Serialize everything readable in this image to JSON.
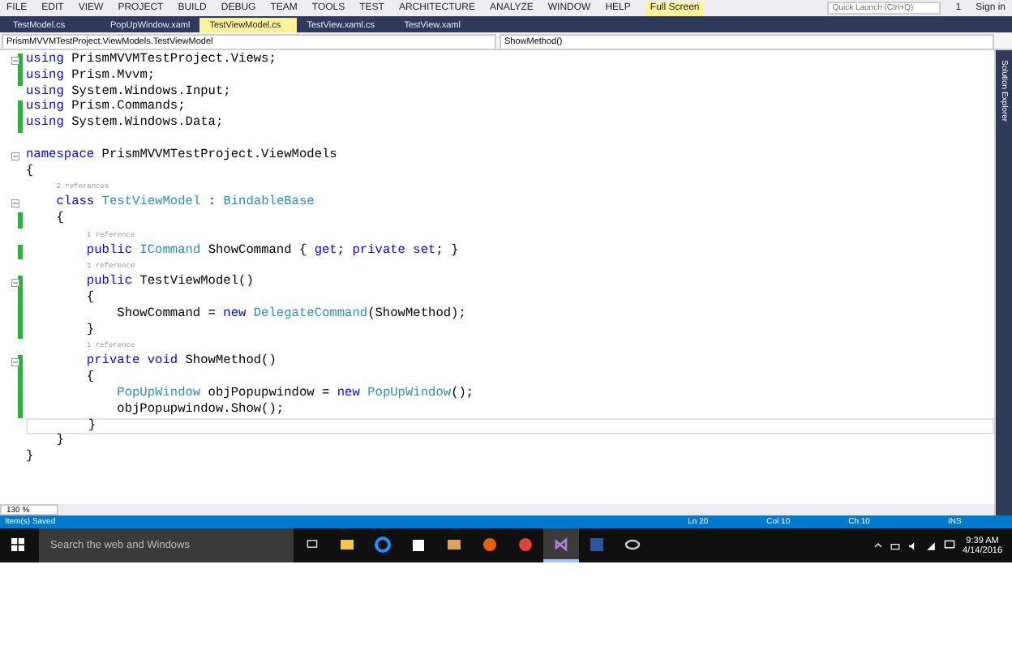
{
  "menu": {
    "items": [
      "FILE",
      "EDIT",
      "VIEW",
      "PROJECT",
      "BUILD",
      "DEBUG",
      "TEAM",
      "TOOLS",
      "TEST",
      "ARCHITECTURE",
      "ANALYZE",
      "WINDOW",
      "HELP"
    ],
    "full_screen": "Full Screen",
    "notification_count": "1",
    "quick_launch": {
      "placeholder": "Quick Launch (Ctrl+Q)"
    },
    "sign_in": "Sign in"
  },
  "tabs": [
    {
      "label": "TestModel.cs",
      "selected": false
    },
    {
      "label": "PopUpWindow.xaml",
      "selected": false
    },
    {
      "label": "TestViewModel.cs",
      "selected": true
    },
    {
      "label": "TestView.xaml.cs",
      "selected": false
    },
    {
      "label": "TestView.xaml",
      "selected": false
    }
  ],
  "nav_bar": {
    "type_scope": "PrismMVVMTestProject.ViewModels.TestViewModel",
    "member": "ShowMethod()"
  },
  "side_panel": {
    "title": "Solution Explorer"
  },
  "code_lines": [
    {
      "kind": "code",
      "foldable": true,
      "changed": true,
      "tokens": [
        {
          "kind": "keyword",
          "text": "using"
        },
        {
          "kind": "plain",
          "text": " PrismMVVMTestProject.Views;"
        }
      ]
    },
    {
      "kind": "code",
      "foldable": false,
      "changed": true,
      "tokens": [
        {
          "kind": "keyword",
          "text": "using"
        },
        {
          "kind": "plain",
          "text": " Prism.Mvvm;"
        }
      ]
    },
    {
      "kind": "code",
      "foldable": false,
      "changed": false,
      "tokens": [
        {
          "kind": "keyword",
          "text": "using"
        },
        {
          "kind": "plain",
          "text": " System.Windows.Input;"
        }
      ]
    },
    {
      "kind": "code",
      "foldable": false,
      "changed": true,
      "tokens": [
        {
          "kind": "keyword",
          "text": "using"
        },
        {
          "kind": "plain",
          "text": " Prism.Commands;"
        }
      ]
    },
    {
      "kind": "code",
      "foldable": false,
      "changed": true,
      "tokens": [
        {
          "kind": "keyword",
          "text": "using"
        },
        {
          "kind": "plain",
          "text": " System.Windows.Data;"
        }
      ]
    },
    {
      "kind": "blank"
    },
    {
      "kind": "code",
      "foldable": true,
      "changed": false,
      "tokens": [
        {
          "kind": "keyword",
          "text": "namespace"
        },
        {
          "kind": "plain",
          "text": " PrismMVVMTestProject.ViewModels"
        }
      ]
    },
    {
      "kind": "code",
      "foldable": false,
      "changed": false,
      "tokens": [
        {
          "kind": "plain",
          "text": "{"
        }
      ]
    },
    {
      "kind": "lens",
      "text": "    2 references"
    },
    {
      "kind": "code",
      "foldable": true,
      "changed": false,
      "tokens": [
        {
          "kind": "keyword",
          "text": "    class"
        },
        {
          "kind": "type",
          "text": " TestViewModel"
        },
        {
          "kind": "plain",
          "text": " : "
        },
        {
          "kind": "type",
          "text": "BindableBase"
        }
      ]
    },
    {
      "kind": "code",
      "foldable": false,
      "changed": true,
      "tokens": [
        {
          "kind": "plain",
          "text": "    {"
        }
      ]
    },
    {
      "kind": "lens",
      "text": "        1 reference"
    },
    {
      "kind": "code",
      "foldable": false,
      "changed": true,
      "tokens": [
        {
          "kind": "keyword",
          "text": "        public"
        },
        {
          "kind": "type",
          "text": " ICommand"
        },
        {
          "kind": "plain",
          "text": " ShowCommand { "
        },
        {
          "kind": "keyword",
          "text": "get"
        },
        {
          "kind": "plain",
          "text": "; "
        },
        {
          "kind": "keyword",
          "text": "private set"
        },
        {
          "kind": "plain",
          "text": "; }"
        }
      ]
    },
    {
      "kind": "lens",
      "text": "        1 reference"
    },
    {
      "kind": "code",
      "foldable": true,
      "changed": true,
      "tokens": [
        {
          "kind": "keyword",
          "text": "        public"
        },
        {
          "kind": "plain",
          "text": " TestViewModel()"
        }
      ]
    },
    {
      "kind": "code",
      "foldable": false,
      "changed": true,
      "tokens": [
        {
          "kind": "plain",
          "text": "        {"
        }
      ]
    },
    {
      "kind": "code",
      "foldable": false,
      "changed": true,
      "tokens": [
        {
          "kind": "plain",
          "text": "            ShowCommand = "
        },
        {
          "kind": "keyword",
          "text": "new"
        },
        {
          "kind": "type",
          "text": " DelegateCommand"
        },
        {
          "kind": "plain",
          "text": "(ShowMethod);"
        }
      ]
    },
    {
      "kind": "code",
      "foldable": false,
      "changed": true,
      "tokens": [
        {
          "kind": "plain",
          "text": "        }"
        }
      ]
    },
    {
      "kind": "lens",
      "text": "        1 reference"
    },
    {
      "kind": "code",
      "foldable": true,
      "changed": true,
      "tokens": [
        {
          "kind": "keyword",
          "text": "        private void"
        },
        {
          "kind": "plain",
          "text": " ShowMethod()"
        }
      ]
    },
    {
      "kind": "code",
      "foldable": false,
      "changed": true,
      "tokens": [
        {
          "kind": "plain",
          "text": "        {"
        }
      ]
    },
    {
      "kind": "code",
      "foldable": false,
      "changed": true,
      "tokens": [
        {
          "kind": "type",
          "text": "            PopUpWindow"
        },
        {
          "kind": "plain",
          "text": " objPopupwindow = "
        },
        {
          "kind": "keyword",
          "text": "new"
        },
        {
          "kind": "type",
          "text": " PopUpWindow"
        },
        {
          "kind": "plain",
          "text": "();"
        }
      ]
    },
    {
      "kind": "code",
      "foldable": false,
      "changed": true,
      "tokens": [
        {
          "kind": "plain",
          "text": "            objPopupwindow.Show();"
        }
      ]
    },
    {
      "kind": "code",
      "foldable": false,
      "changed": false,
      "current": true,
      "tokens": [
        {
          "kind": "plain",
          "text": "        }"
        }
      ]
    },
    {
      "kind": "code",
      "foldable": false,
      "changed": false,
      "tokens": [
        {
          "kind": "plain",
          "text": "    }"
        }
      ]
    },
    {
      "kind": "code",
      "foldable": false,
      "changed": false,
      "tokens": [
        {
          "kind": "plain",
          "text": "}"
        }
      ]
    }
  ],
  "zoom": "130 %",
  "status_bar": {
    "message": "Item(s) Saved",
    "line": "Ln 20",
    "column": "Col 10",
    "char": "Ch 10",
    "mode": "INS"
  },
  "taskbar": {
    "search": {
      "placeholder": "Search the web and Windows"
    },
    "apps": [
      {
        "kind": "explorer",
        "selected": false
      },
      {
        "kind": "edge",
        "selected": false
      },
      {
        "kind": "store",
        "selected": false
      },
      {
        "kind": "media",
        "selected": false
      },
      {
        "kind": "firefox",
        "selected": false
      },
      {
        "kind": "chrome",
        "selected": false
      },
      {
        "kind": "visualstudio",
        "selected": true
      },
      {
        "kind": "word",
        "selected": false
      },
      {
        "kind": "eye",
        "selected": false
      }
    ],
    "time": "9:39 AM",
    "date": "4/14/2016"
  }
}
